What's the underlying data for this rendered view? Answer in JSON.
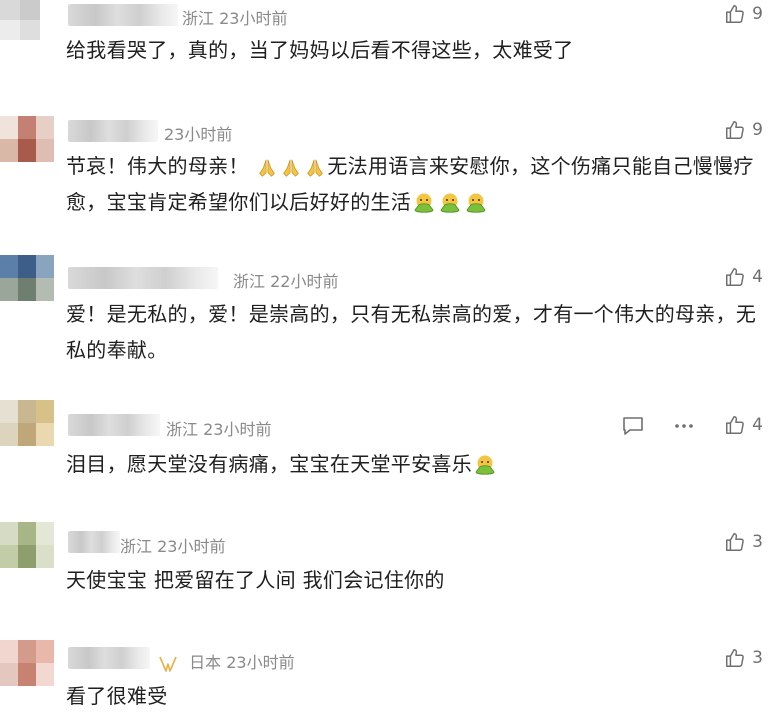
{
  "comments": [
    {
      "location": "浙江",
      "time": "23小时前",
      "text": "给我看哭了，真的，当了妈妈以后看不得这些，太难受了",
      "likes": "9"
    },
    {
      "location": "",
      "time": "23小时前",
      "text_a": "节哀！伟大的母亲！",
      "text_b": "无法用语言来安慰你，这个伤痛只能自己慢慢疗愈，宝宝肯定希望你们以后好好的生活",
      "likes": "9"
    },
    {
      "location": "浙江",
      "time": "22小时前",
      "text": "爱！是无私的，爱！是崇高的，只有无私崇高的爱，才有一个伟大的母亲，无私的奉献。",
      "likes": "4"
    },
    {
      "location": "浙江",
      "time": "23小时前",
      "text": "泪目，愿天堂没有病痛，宝宝在天堂平安喜乐",
      "likes": "4"
    },
    {
      "location": "浙江",
      "time": "23小时前",
      "text": "天使宝宝 把爱留在了人间 我们会记住你的",
      "likes": "3"
    },
    {
      "location": "日本",
      "time": "23小时前",
      "text": "看了很难受",
      "likes": "3"
    }
  ],
  "colors": {
    "meta": "#8a8a8a",
    "text": "#1f1f1f",
    "icon": "#6f6f6f",
    "emoji_green": "#7cbf3a",
    "emoji_yellow": "#f4c542"
  },
  "icons": [
    "thumbs-up-icon",
    "reply-icon",
    "more-icon",
    "pray-emoji",
    "nauseated-emoji",
    "vip-badge-icon"
  ]
}
